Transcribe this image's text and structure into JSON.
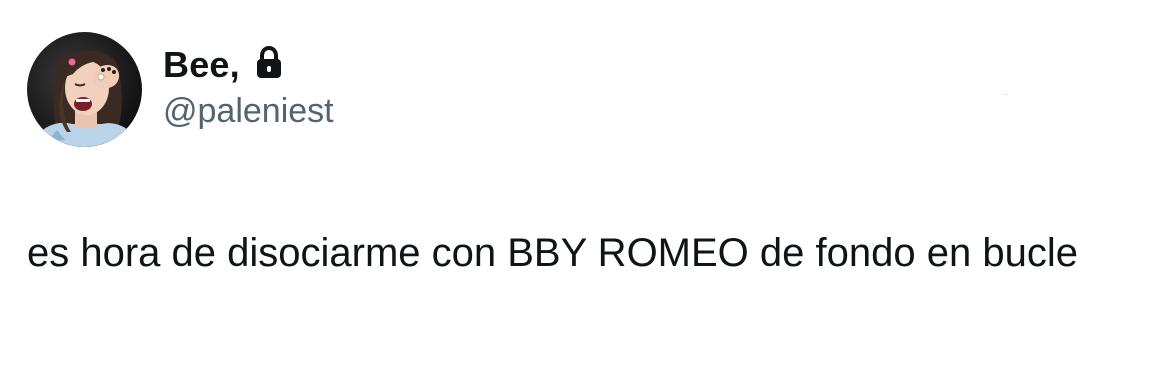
{
  "author": {
    "display_name": "Bee,",
    "handle": "@paleniest",
    "protected_icon": "lock-icon",
    "avatar_icon": "profile-photo"
  },
  "tweet": {
    "text": "es hora de disociarme con BBY ROMEO de fondo en bucle"
  },
  "colors": {
    "text_primary": "#0f1419",
    "text_secondary": "#536471",
    "background": "#ffffff"
  }
}
